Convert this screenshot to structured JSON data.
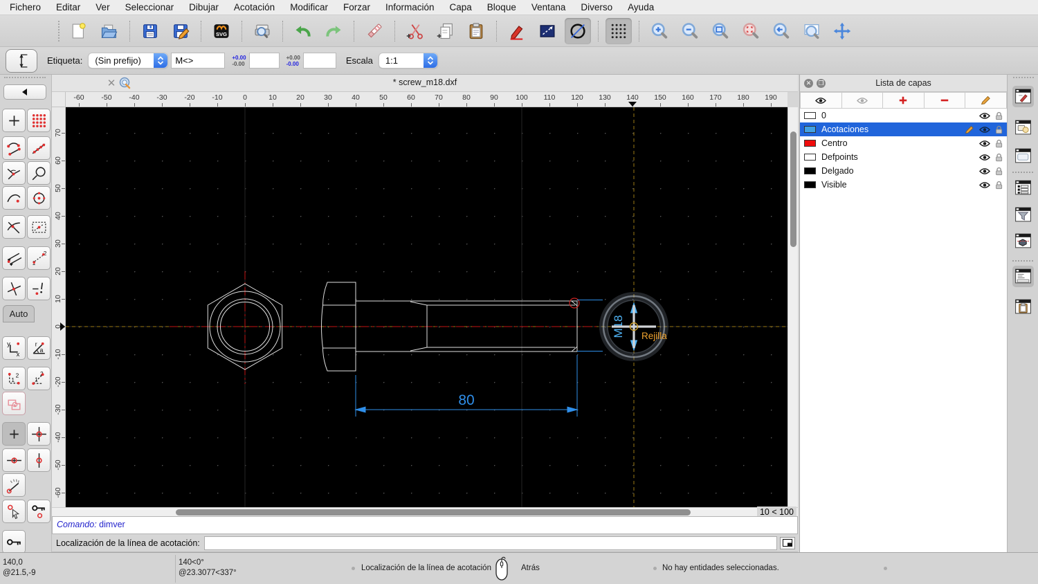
{
  "menubar": {
    "items": [
      "Fichero",
      "Editar",
      "Ver",
      "Seleccionar",
      "Dibujar",
      "Acotación",
      "Modificar",
      "Forzar",
      "Información",
      "Capa",
      "Bloque",
      "Ventana",
      "Diverso",
      "Ayuda"
    ]
  },
  "main_toolbar": {
    "icons": [
      "new-document",
      "open-file",
      "save",
      "save-as",
      "svg-export",
      "print-preview",
      "undo",
      "redo",
      "delete",
      "cut",
      "copy",
      "paste",
      "draw-pen",
      "line-tool",
      "circle-tool",
      "grid-toggle",
      "zoom-in",
      "zoom-out",
      "zoom-auto",
      "zoom-selection",
      "zoom-previous",
      "zoom-window",
      "pan"
    ]
  },
  "tool_options": {
    "tool_icon": "vertical-dimension",
    "etiqueta_label": "Etiqueta:",
    "prefix_selected": "(Sin prefijo)",
    "label_value": "M<>",
    "tolerance_upper": "+0.00",
    "tolerance_lower": "-0.00",
    "escala_label": "Escala",
    "escala_value": "1:1"
  },
  "snap_toolbar": {
    "auto_label": "Auto",
    "icons": [
      "back",
      "snap-free",
      "snap-grid",
      "snap-endpoints",
      "snap-on-entity",
      "snap-center",
      "snap-middle",
      "snap-distance",
      "snap-center-point",
      "snap-intersection",
      "snap-intersection-manual",
      "restrict-orthogonal",
      "restrict-points",
      "restrict-horizontal",
      "restrict-vertical",
      "coord-cartesian",
      "coord-polar",
      "coord-relative",
      "coord-relative-polar",
      "selection-tool",
      "mark-plus",
      "mark-target",
      "mark-horizontal",
      "mark-vertical",
      "angle-gauge",
      "pick-point",
      "lock-relative-zero",
      "relative-zero-key"
    ]
  },
  "document_tab": {
    "title": "* screw_m18.dxf"
  },
  "canvas": {
    "top_ruler": {
      "values": [
        -60,
        -50,
        -40,
        -30,
        -20,
        -10,
        0,
        10,
        20,
        30,
        40,
        50,
        60,
        70,
        80,
        90,
        100,
        110,
        120,
        130,
        140,
        150,
        160,
        170,
        180,
        190
      ],
      "marker_value": 140
    },
    "left_ruler": {
      "values": [
        70,
        60,
        50,
        40,
        30,
        20,
        10,
        0,
        -10,
        -20,
        -30,
        -40,
        -50,
        -60
      ],
      "marker_value": 0
    },
    "grid_status": "10 < 100",
    "dimension_label": "80",
    "dimension_preview_label": "M18",
    "snap_hint": "Rejilla",
    "colors": {
      "background": "#000000",
      "entity": "#e0e0e0",
      "centerline": "#c41414",
      "dimension": "#2f8fea",
      "preview": "#4fb3f5",
      "crosshair": "#9c7a14",
      "hint": "#f0a32e"
    }
  },
  "layer_panel": {
    "title": "Lista de capas",
    "toolbar_icons": [
      "show-all-layers",
      "hide-all-layers",
      "add-layer",
      "remove-layer",
      "edit-layer"
    ],
    "layers": [
      {
        "name": "0",
        "color": "#ffffff",
        "selected": false
      },
      {
        "name": "Acotaciones",
        "color": "#42a1e4",
        "selected": true
      },
      {
        "name": "Centro",
        "color": "#f00c0c",
        "selected": false
      },
      {
        "name": "Defpoints",
        "color": "#ffffff",
        "selected": false
      },
      {
        "name": "Delgado",
        "color": "#000000",
        "selected": false
      },
      {
        "name": "Visible",
        "color": "#000000",
        "selected": false
      }
    ]
  },
  "dock_strip": {
    "icons": [
      "pen-panel",
      "block-panel",
      "library-panel",
      "list-panel",
      "filter-panel",
      "block-list-panel",
      "command-panel",
      "clipboard-panel"
    ]
  },
  "command_area": {
    "history_label": "Comando:",
    "history_command": "dimver",
    "prompt_label": "Localización de la línea de acotación:",
    "input_value": ""
  },
  "statusbar": {
    "abs_coord": "140,0",
    "rel_coord": "@21.5,-9",
    "abs_polar": "140<0°",
    "rel_polar": "@23.3077<337°",
    "left_mouse_hint": "Localización de la línea de acotación",
    "right_mouse_hint": "Atrás",
    "selection_status": "No hay entidades seleccionadas."
  }
}
